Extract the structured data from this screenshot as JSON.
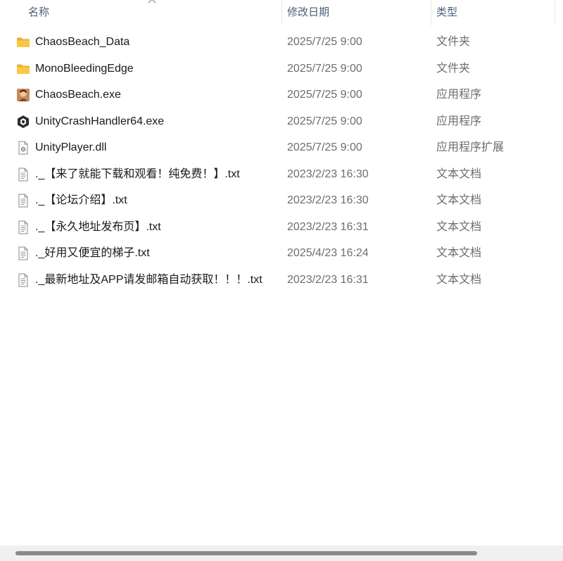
{
  "columns": {
    "name": "名称",
    "date": "修改日期",
    "type": "类型"
  },
  "files": [
    {
      "name": "ChaosBeach_Data",
      "date": "2025/7/25 9:00",
      "type": "文件夹",
      "icon": "folder-icon"
    },
    {
      "name": "MonoBleedingEdge",
      "date": "2025/7/25 9:00",
      "type": "文件夹",
      "icon": "folder-icon"
    },
    {
      "name": "ChaosBeach.exe",
      "date": "2025/7/25 9:00",
      "type": "应用程序",
      "icon": "app-exe-icon"
    },
    {
      "name": "UnityCrashHandler64.exe",
      "date": "2025/7/25 9:00",
      "type": "应用程序",
      "icon": "unity-icon"
    },
    {
      "name": "UnityPlayer.dll",
      "date": "2025/7/25 9:00",
      "type": "应用程序扩展",
      "icon": "dll-file-icon"
    },
    {
      "name": "._【来了就能下载和观看！纯免费！】.txt",
      "date": "2023/2/23 16:30",
      "type": "文本文档",
      "icon": "text-file-icon"
    },
    {
      "name": "._【论坛介绍】.txt",
      "date": "2023/2/23 16:30",
      "type": "文本文档",
      "icon": "text-file-icon"
    },
    {
      "name": "._【永久地址发布页】.txt",
      "date": "2023/2/23 16:31",
      "type": "文本文档",
      "icon": "text-file-icon"
    },
    {
      "name": "._好用又便宜的梯子.txt",
      "date": "2025/4/23 16:24",
      "type": "文本文档",
      "icon": "text-file-icon"
    },
    {
      "name": "._最新地址及APP请发邮箱自动获取！！！.txt",
      "date": "2023/2/23 16:31",
      "type": "文本文档",
      "icon": "text-file-icon"
    }
  ],
  "colors": {
    "header_text": "#4c607a",
    "name_text": "#1a1a1a",
    "meta_text": "#6d6d6d",
    "folder": "#f7c948"
  }
}
